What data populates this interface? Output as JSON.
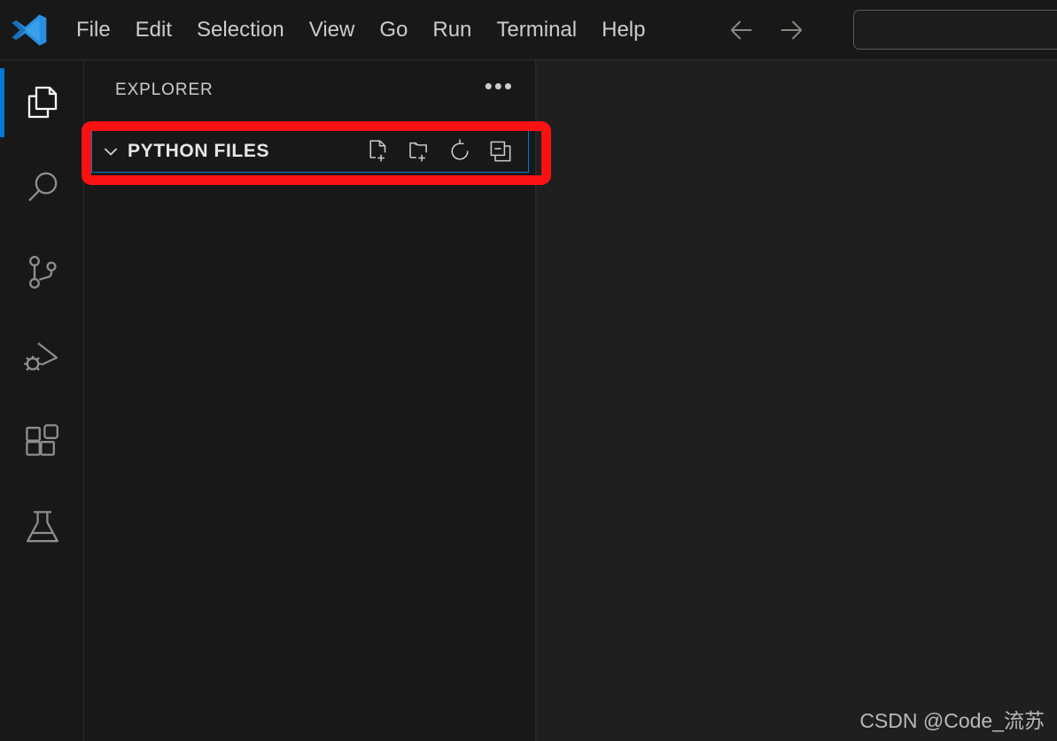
{
  "app": {
    "name": "Visual Studio Code",
    "logo_icon": "vscode-logo-icon",
    "theme_background": "#1f1f1f",
    "accent_color": "#0078d4"
  },
  "titlebar": {
    "menus": [
      {
        "label": "File"
      },
      {
        "label": "Edit"
      },
      {
        "label": "Selection"
      },
      {
        "label": "View"
      },
      {
        "label": "Go"
      },
      {
        "label": "Run"
      },
      {
        "label": "Terminal"
      },
      {
        "label": "Help"
      }
    ],
    "navigation": {
      "back_icon": "arrow-left-icon",
      "forward_icon": "arrow-right-icon"
    },
    "search": {
      "value": "",
      "placeholder": ""
    }
  },
  "activitybar": {
    "items": [
      {
        "name": "explorer",
        "icon": "files-icon",
        "active": true
      },
      {
        "name": "search",
        "icon": "search-icon",
        "active": false
      },
      {
        "name": "source-control",
        "icon": "source-control-icon",
        "active": false
      },
      {
        "name": "run-and-debug",
        "icon": "run-debug-icon",
        "active": false
      },
      {
        "name": "extensions",
        "icon": "extensions-icon",
        "active": false
      },
      {
        "name": "testing",
        "icon": "beaker-icon",
        "active": false
      }
    ]
  },
  "sidebar": {
    "title": "EXPLORER",
    "more_actions_label": "•••",
    "more_actions_icon": "ellipsis-icon",
    "section": {
      "label": "PYTHON FILES",
      "expanded": true,
      "chevron_icon": "chevron-down-icon",
      "focused": true,
      "actions": [
        {
          "name": "new-file",
          "icon": "new-file-icon"
        },
        {
          "name": "new-folder",
          "icon": "new-folder-icon"
        },
        {
          "name": "refresh",
          "icon": "refresh-icon"
        },
        {
          "name": "collapse-all",
          "icon": "collapse-all-icon"
        }
      ],
      "items": []
    }
  },
  "annotation": {
    "color": "#fa1111",
    "target": "PYTHON FILES"
  },
  "watermark": {
    "text": "CSDN @Code_流苏"
  }
}
